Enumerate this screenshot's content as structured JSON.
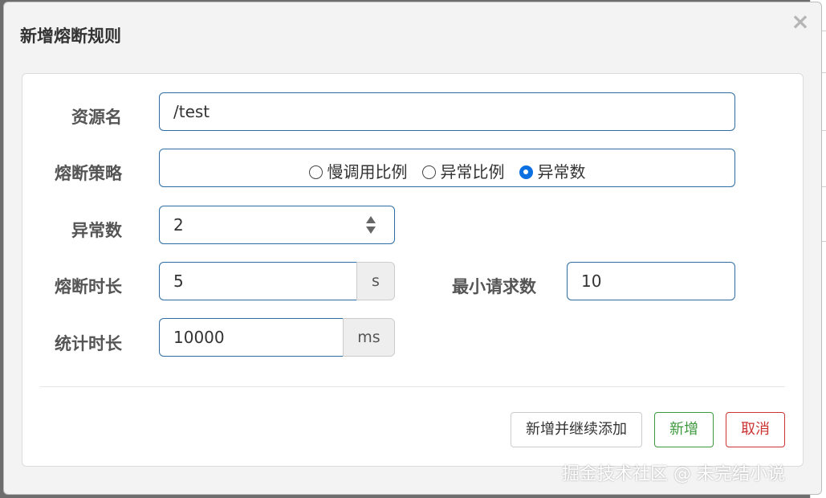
{
  "dialog": {
    "title": "新增熔断规则",
    "close_symbol": "×"
  },
  "form": {
    "resource": {
      "label": "资源名",
      "value": "/test"
    },
    "strategy": {
      "label": "熔断策略",
      "options": [
        {
          "label": "慢调用比例",
          "checked": false
        },
        {
          "label": "异常比例",
          "checked": false
        },
        {
          "label": "异常数",
          "checked": true
        }
      ]
    },
    "exception_count": {
      "label": "异常数",
      "value": "2"
    },
    "break_duration": {
      "label": "熔断时长",
      "value": "5",
      "unit": "s"
    },
    "min_requests": {
      "label": "最小请求数",
      "value": "10"
    },
    "stat_duration": {
      "label": "统计时长",
      "value": "10000",
      "unit": "ms"
    }
  },
  "footer": {
    "add_continue_label": "新增并继续添加",
    "add_label": "新增",
    "cancel_label": "取消"
  },
  "watermark": "掘金技术社区 @ 未完结小说",
  "colors": {
    "primary_border": "#2e6da4",
    "radio_checked": "#0a6fe0",
    "success": "#3c9a3c",
    "danger": "#cc3333"
  }
}
